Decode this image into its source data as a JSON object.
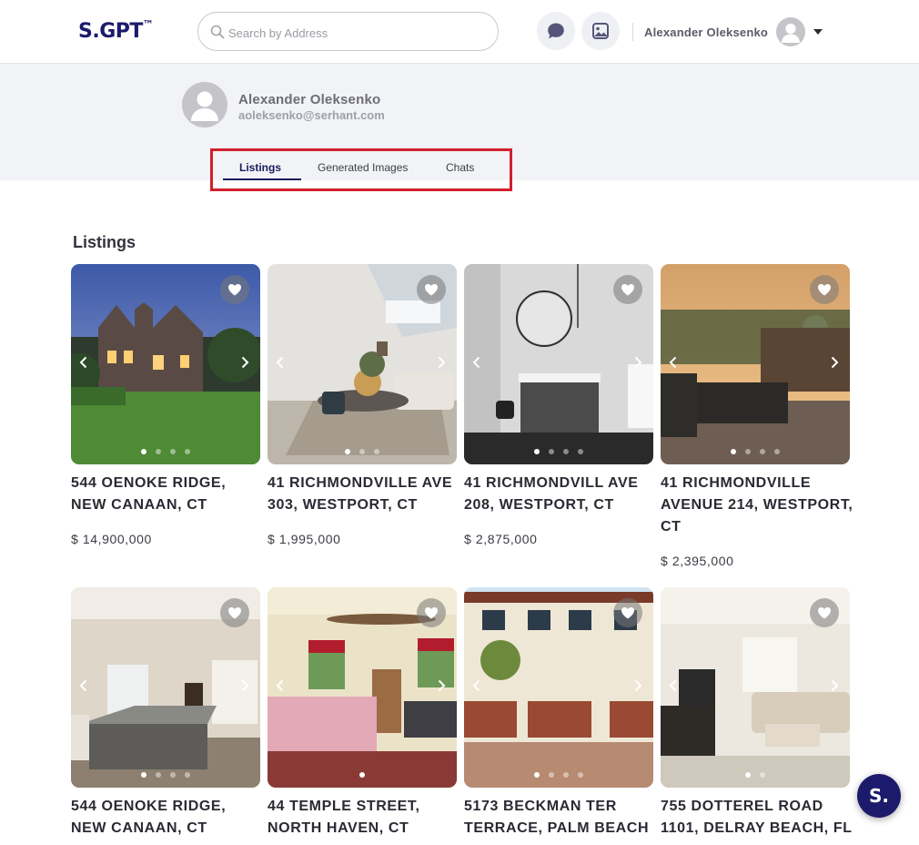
{
  "header": {
    "logo": "S.GPT",
    "logo_mark": "™",
    "search_placeholder": "Search by Address",
    "user_name": "Alexander Oleksenko",
    "icons": [
      "search-icon",
      "chat-bubble-icon",
      "image-gallery-icon",
      "avatar-icon",
      "caret-down-icon"
    ]
  },
  "profile": {
    "name": "Alexander Oleksenko",
    "email": "aoleksenko@serhant.com"
  },
  "tabs": [
    {
      "label": "Listings",
      "active": true
    },
    {
      "label": "Generated Images",
      "active": false
    },
    {
      "label": "Chats",
      "active": false
    }
  ],
  "listings": {
    "title": "Listings",
    "cards": [
      {
        "address": "544 OENOKE RIDGE, NEW CANAAN, CT",
        "price": "$ 14,900,000"
      },
      {
        "address": "41 RICHMONDVILLE AVE 303, WESTPORT, CT",
        "price": "$ 1,995,000"
      },
      {
        "address": "41 RICHMONDVILL AVE 208, WESTPORT, CT",
        "price": "$ 2,875,000"
      },
      {
        "address": "41 RICHMONDVILLE AVENUE 214, WESTPORT, CT",
        "price": "$ 2,395,000"
      },
      {
        "address": "544 OENOKE RIDGE, NEW CANAAN, CT",
        "price": ""
      },
      {
        "address": "44 TEMPLE STREET, NORTH HAVEN, CT",
        "price": ""
      },
      {
        "address": "5173 BECKMAN TER TERRACE, PALM BEACH",
        "price": ""
      },
      {
        "address": "755 DOTTEREL ROAD 1101, DELRAY BEACH, FL",
        "price": ""
      }
    ]
  },
  "fab": {
    "label": "S."
  },
  "colors": {
    "brand": "#1c1b6b",
    "highlight_border": "#d11f2c",
    "band": "#f2f3f6"
  }
}
